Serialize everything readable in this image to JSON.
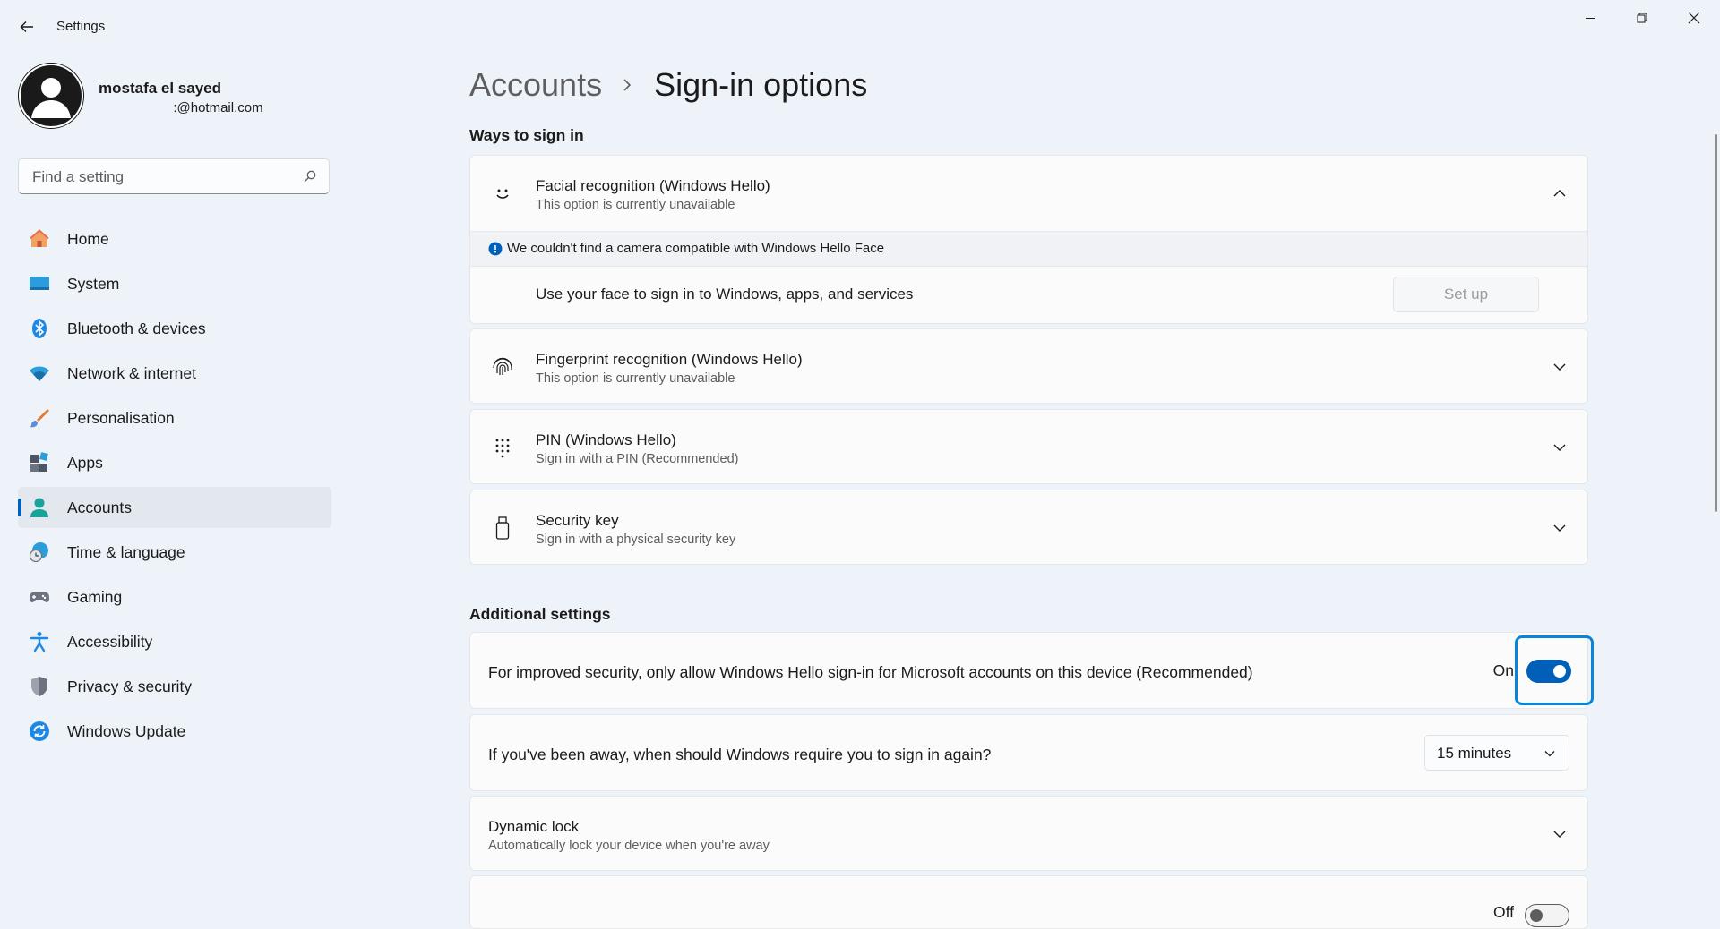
{
  "window": {
    "title": "Settings"
  },
  "profile": {
    "name": "mostafa el sayed",
    "email": "                    :@hotmail.com"
  },
  "search": {
    "placeholder": "Find a setting"
  },
  "sidebar": {
    "items": [
      {
        "label": "Home",
        "icon": "home-icon",
        "active": false
      },
      {
        "label": "System",
        "icon": "system-icon",
        "active": false
      },
      {
        "label": "Bluetooth & devices",
        "icon": "bluetooth-icon",
        "active": false
      },
      {
        "label": "Network & internet",
        "icon": "wifi-icon",
        "active": false
      },
      {
        "label": "Personalisation",
        "icon": "brush-icon",
        "active": false
      },
      {
        "label": "Apps",
        "icon": "apps-icon",
        "active": false
      },
      {
        "label": "Accounts",
        "icon": "person-icon",
        "active": true
      },
      {
        "label": "Time & language",
        "icon": "globe-clock-icon",
        "active": false
      },
      {
        "label": "Gaming",
        "icon": "gamepad-icon",
        "active": false
      },
      {
        "label": "Accessibility",
        "icon": "accessibility-icon",
        "active": false
      },
      {
        "label": "Privacy & security",
        "icon": "shield-icon",
        "active": false
      },
      {
        "label": "Windows Update",
        "icon": "update-icon",
        "active": false
      }
    ]
  },
  "breadcrumb": {
    "parent": "Accounts",
    "current": "Sign-in options"
  },
  "ways": {
    "title": "Ways to sign in",
    "face": {
      "title": "Facial recognition (Windows Hello)",
      "subtitle": "This option is currently unavailable",
      "info": "We couldn't find a camera compatible with Windows Hello Face",
      "row_text": "Use your face to sign in to Windows, apps, and services",
      "button": "Set up"
    },
    "fingerprint": {
      "title": "Fingerprint recognition (Windows Hello)",
      "subtitle": "This option is currently unavailable"
    },
    "pin": {
      "title": "PIN (Windows Hello)",
      "subtitle": "Sign in with a PIN (Recommended)"
    },
    "key": {
      "title": "Security key",
      "subtitle": "Sign in with a physical security key"
    }
  },
  "additional": {
    "title": "Additional settings",
    "hello_only": {
      "text": "For improved security, only allow Windows Hello sign-in for Microsoft accounts on this device (Recommended)",
      "state": "On"
    },
    "away": {
      "text": "If you've been away, when should Windows require you to sign in again?",
      "value": "15 minutes"
    },
    "dynamic": {
      "title": "Dynamic lock",
      "subtitle": "Automatically lock your device when you're away"
    },
    "auto_restart": {
      "state": "Off"
    }
  },
  "colors": {
    "accent": "#005fb8",
    "focus": "#0a84d6",
    "background": "#eef3f9"
  }
}
